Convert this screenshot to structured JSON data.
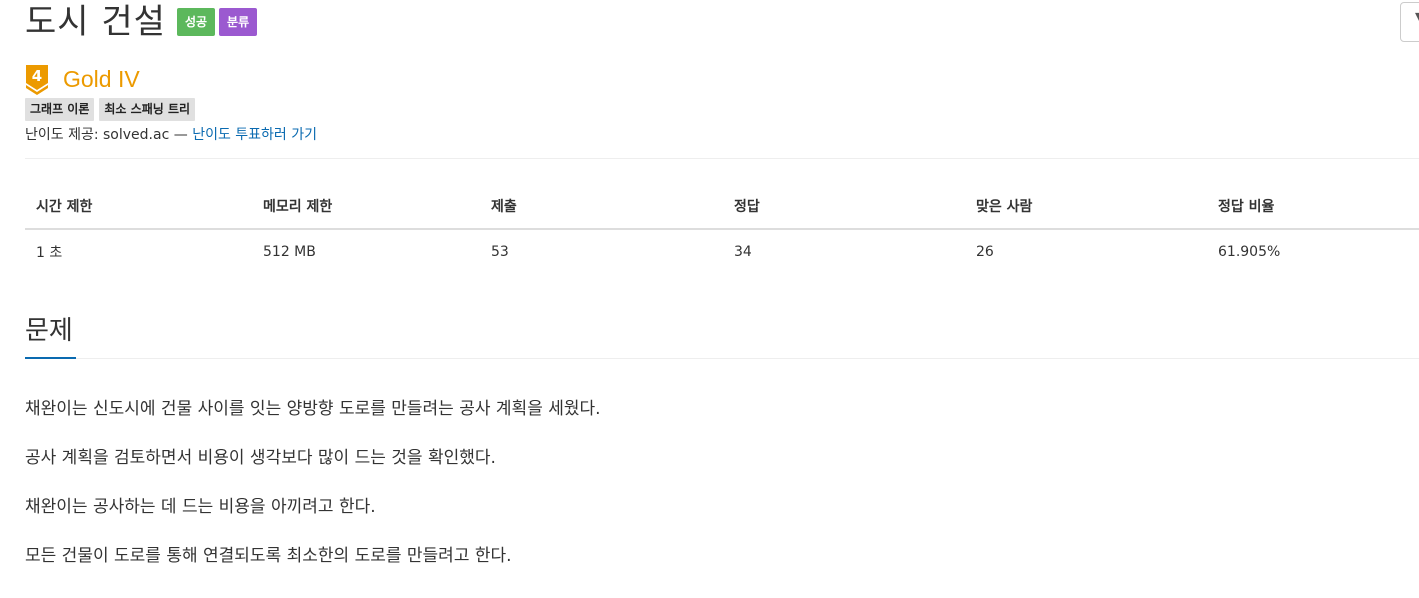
{
  "header": {
    "title": "도시 건설",
    "badges": [
      {
        "label": "성공",
        "color": "#5cb85c"
      },
      {
        "label": "분류",
        "color": "#9b59d0"
      }
    ]
  },
  "tier": {
    "number": "4",
    "name": "Gold IV",
    "color": "#ec9a00"
  },
  "algorithm_tags": [
    "그래프 이론",
    "최소 스패닝 트리"
  ],
  "credit": {
    "prefix": "난이도 제공: solved.ac —",
    "link_label": "난이도 투표하러 가기"
  },
  "stats": {
    "headers": [
      "시간 제한",
      "메모리 제한",
      "제출",
      "정답",
      "맞은 사람",
      "정답 비율"
    ],
    "values": [
      "1 초",
      "512 MB",
      "53",
      "34",
      "26",
      "61.905%"
    ]
  },
  "section": {
    "title": "문제",
    "paragraphs": [
      "채완이는 신도시에 건물 사이를 잇는 양방향 도로를 만들려는 공사 계획을 세웠다.",
      "공사 계획을 검토하면서 비용이 생각보다 많이 드는 것을 확인했다.",
      "채완이는 공사하는 데 드는 비용을 아끼려고 한다.",
      "모든 건물이 도로를 통해 연결되도록 최소한의 도로를 만들려고 한다."
    ]
  },
  "colors": {
    "accent": "#0a6ab0",
    "success": "#5cb85c",
    "classify": "#9b59d0",
    "gold": "#ec9a00"
  }
}
